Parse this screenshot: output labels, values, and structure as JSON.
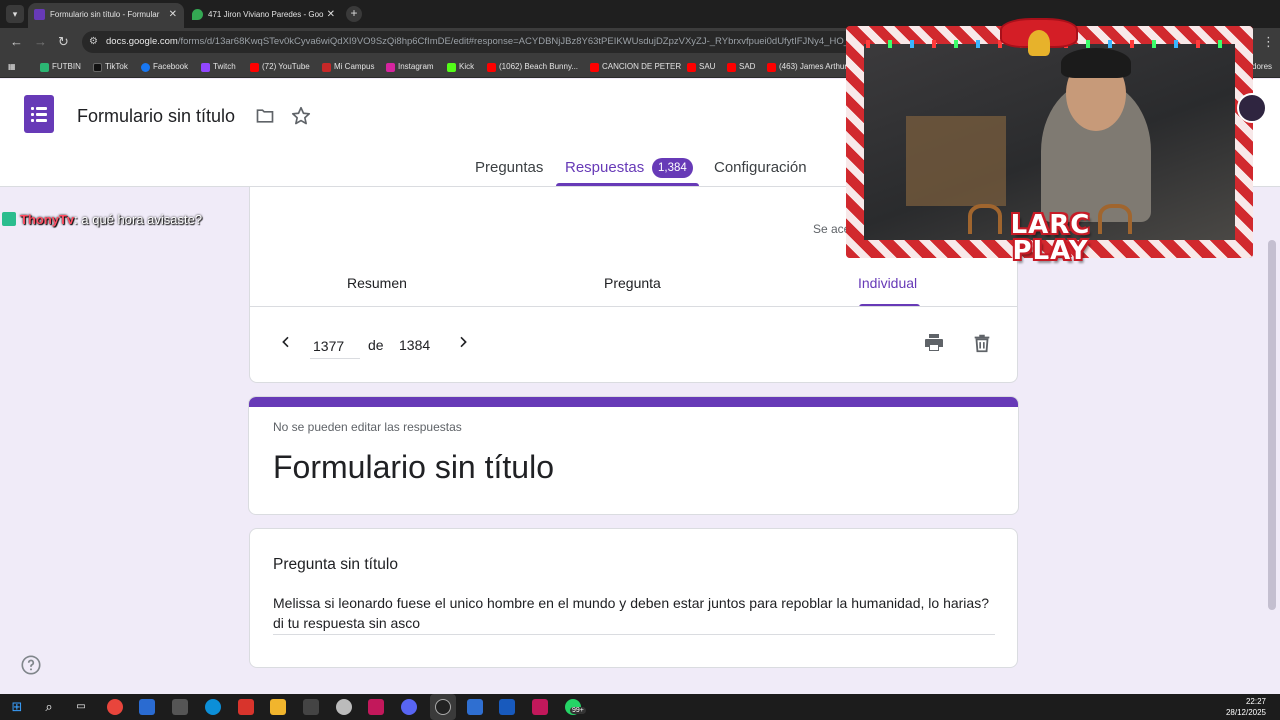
{
  "browser": {
    "tabs": [
      {
        "title": "Formulario sin título - Formular",
        "active": true
      },
      {
        "title": "471 Jiron Viviano Paredes - Goo",
        "active": false
      }
    ],
    "url_host": "docs.google.com",
    "url_path": "/forms/d/13ar68KwqSTev0kCyva6wiQdXI9VO9SzQi8hp6CfImDE/edit#response=ACYDBNjJBz8Y63tPEIKWUsdujDZpzVXyZJ-_RYbrxvfpuei0dUfytIFJNy4_HO_J-qwey30",
    "bookmarks": [
      "FUTBIN",
      "TikTok",
      "Facebook",
      "Twitch",
      "(72) YouTube",
      "Mi Campus",
      "Instagram",
      "Kick",
      "(1062) Beach Bunny...",
      "CANCION DE PETER",
      "SAU",
      "SAD",
      "(463) James Arthur"
    ],
    "bookmarks_overflow": "dores"
  },
  "forms": {
    "doc_title": "Formulario sin título",
    "tabs": {
      "preguntas": "Preguntas",
      "respuestas": "Respuestas",
      "configuracion": "Configuración"
    },
    "responses_count": "1,384",
    "accepting_partial": "Se ace",
    "response_tabs": {
      "resumen": "Resumen",
      "pregunta": "Pregunta",
      "individual": "Individual"
    },
    "pager": {
      "current": "1377",
      "of_label": "de",
      "total": "1384"
    },
    "no_edit_notice": "No se pueden editar las respuestas",
    "form_title": "Formulario sin título",
    "question_title": "Pregunta sin título",
    "answer": "Melissa si leonardo fuese el unico hombre en el mundo y deben estar juntos para repoblar la humanidad, lo harias? di tu respuesta sin asco"
  },
  "chat": {
    "user": "ThonyTv",
    "message": ": a qué hora avisaste?"
  },
  "stream_overlay": {
    "logo_line1": "LARC",
    "logo_line2": "PLAY"
  },
  "taskbar": {
    "time": "22:27",
    "date": "28/12/2025",
    "whatsapp_badge": "99+"
  },
  "colors": {
    "accent": "#673ab7",
    "background": "#f0ebf8",
    "chat_user": "#ff4f64"
  }
}
